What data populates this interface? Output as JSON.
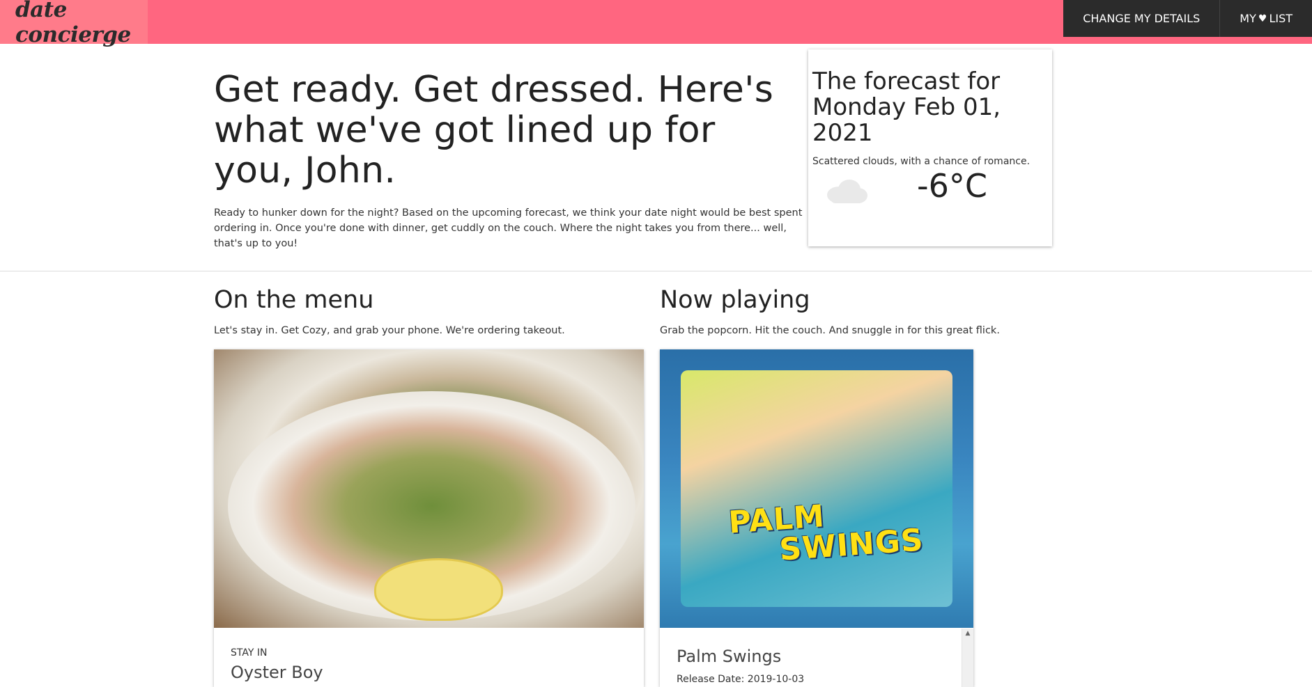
{
  "app": {
    "logo_text": "date concierge"
  },
  "nav": {
    "change_details": "CHANGE MY DETAILS",
    "my_list_prefix": "MY",
    "my_list_heart": "♥",
    "my_list_suffix": "LIST"
  },
  "hero": {
    "title": "Get ready. Get dressed. Here's what we've got lined up for you, John.",
    "text": "Ready to hunker down for the night? Based on the upcoming forecast, we think your date night would be best spent ordering in. Once you're done with dinner, get cuddly on the couch. Where the night takes you from there... well, that's up to you!"
  },
  "forecast": {
    "title": "The forecast for",
    "date": "Monday Feb 01, 2021",
    "description": "Scattered clouds, with a chance of romance.",
    "temperature": "-6°C",
    "icon": "cloud-icon"
  },
  "menu": {
    "title": "On the menu",
    "subtitle": "Let's stay in. Get Cozy, and grab your phone. We're ordering takeout.",
    "card": {
      "label": "STAY IN",
      "name": "Oyster Boy"
    }
  },
  "movie": {
    "title": "Now playing",
    "subtitle": "Grab the popcorn. Hit the couch. And snuggle in for this great flick.",
    "card": {
      "poster_title_line1": "PALM",
      "poster_title_line2": "SWINGS",
      "name": "Palm Swings",
      "release": "Release Date: 2019-10-03"
    }
  },
  "colors": {
    "topbar": "#ff6680",
    "logo_bg": "#ff7b8a",
    "nav_bg": "#2b2b2b"
  }
}
